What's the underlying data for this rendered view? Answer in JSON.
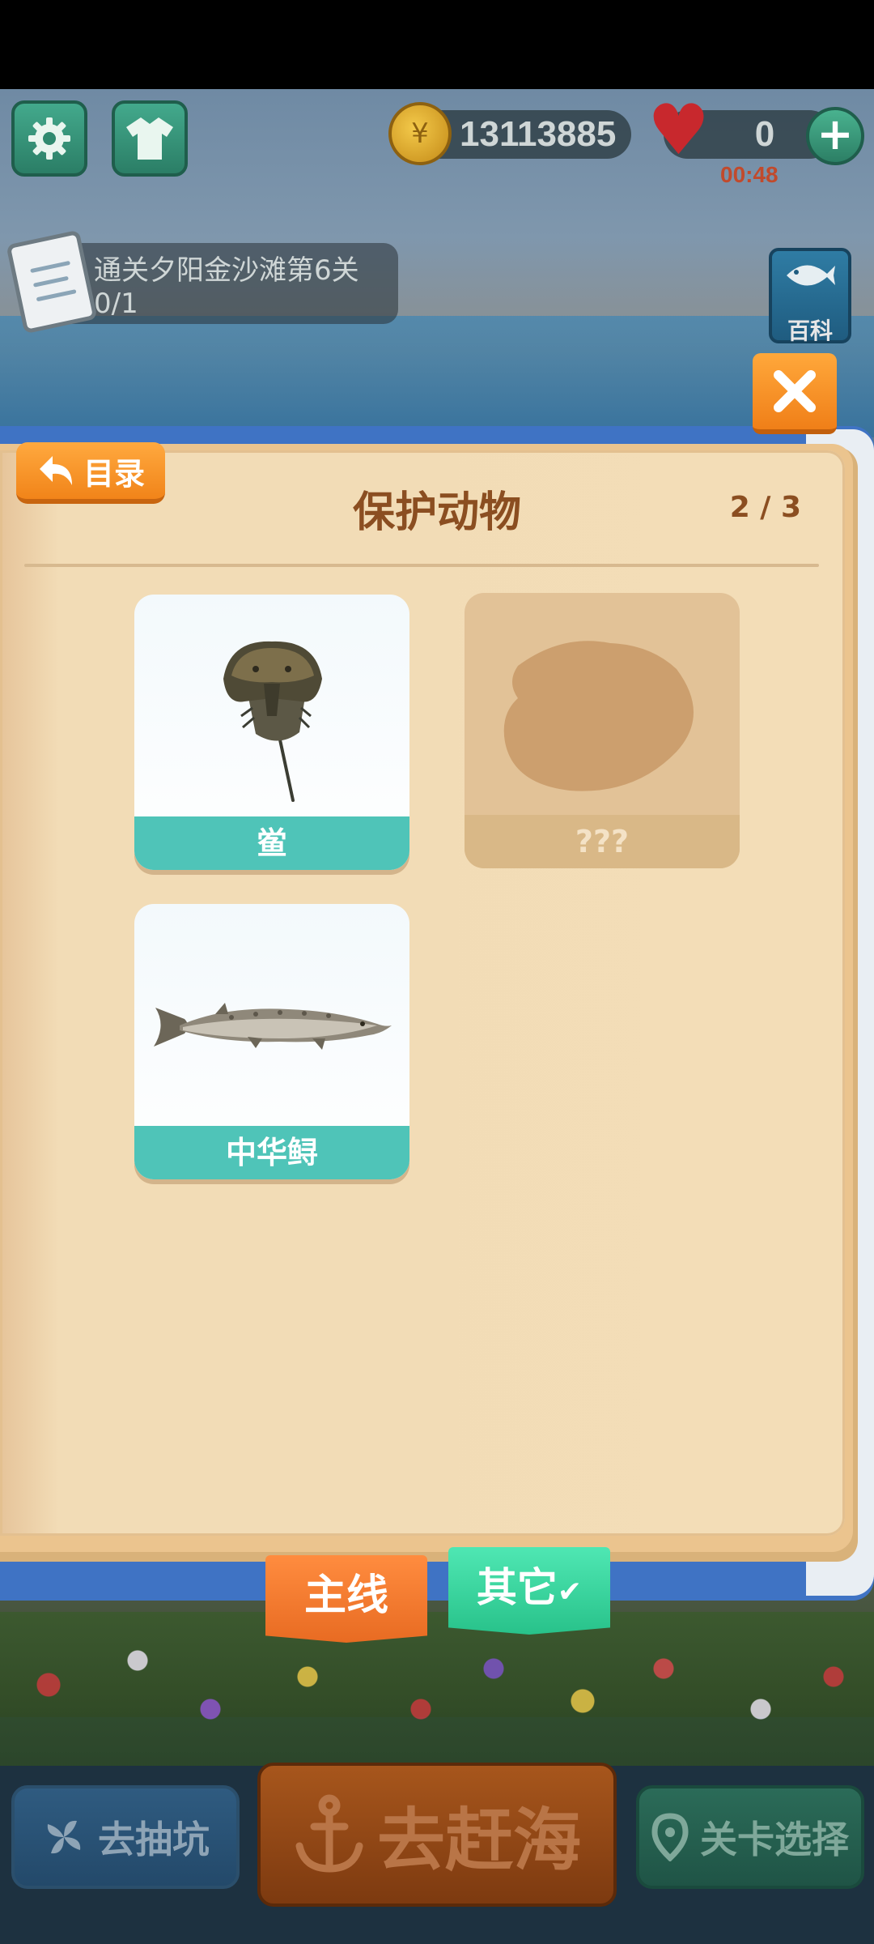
{
  "hud": {
    "coins": "13113885",
    "lives": "0",
    "life_timer": "00:48",
    "add_lives_symbol": "+"
  },
  "quest": {
    "text": "通关夕阳金沙滩第6关 0/1"
  },
  "sidebar": {
    "encyclopedia_label": "百科"
  },
  "book": {
    "back_label": "目录",
    "title": "保护动物",
    "page_counter": "2 / 3",
    "cards": [
      {
        "label": "鲎",
        "discovered": true,
        "icon": "horseshoe-crab"
      },
      {
        "label": "???",
        "discovered": false,
        "icon": "unknown-silhouette"
      },
      {
        "label": "中华鲟",
        "discovered": true,
        "icon": "chinese-sturgeon"
      }
    ]
  },
  "tabs": {
    "main_label": "主线",
    "other_label": "其它"
  },
  "bottom_bar": {
    "gacha_label": "去抽坑",
    "go_sea_label": "去赶海",
    "level_select_label": "关卡选择"
  },
  "colors": {
    "accent_orange": "#f18419",
    "card_label_teal": "#4fc4b8",
    "tab_active_green": "#28c28a",
    "title_brown": "#8b4e21"
  }
}
